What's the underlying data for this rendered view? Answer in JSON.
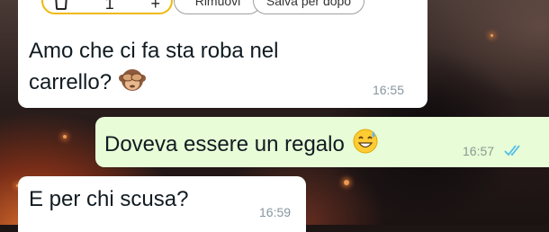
{
  "cart_card": {
    "quantity": "1",
    "remove_label": "Rimuovi",
    "save_later_label": "Salva per dopo",
    "accent_color": "#f0b90a"
  },
  "messages": [
    {
      "direction": "incoming",
      "text": "Amo che ci fa sta roba nel carrello?",
      "emoji": "see-no-evil-monkey-icon",
      "time": "16:55"
    },
    {
      "direction": "outgoing",
      "text": "Doveva essere un regalo",
      "emoji": "grinning-sweat-icon",
      "time": "16:57",
      "status": "read"
    },
    {
      "direction": "incoming",
      "text": "E per chi scusa?",
      "time": "16:59"
    }
  ],
  "colors": {
    "incoming_bubble": "#ffffff",
    "outgoing_bubble": "#e7fcd7",
    "read_receipt": "#53bdeb",
    "time_text": "#8696a0"
  }
}
